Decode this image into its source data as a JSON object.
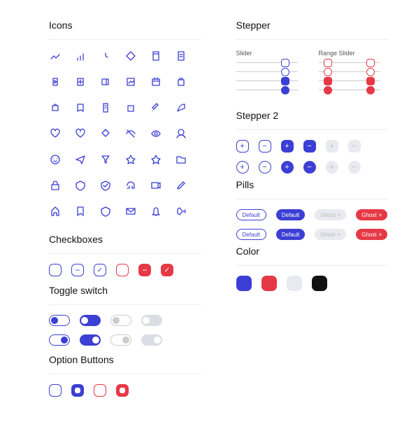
{
  "sections": {
    "icons": "Icons",
    "checkboxes": "Checkboxes",
    "toggle": "Toggle switch",
    "option": "Option Buttons",
    "stepper": "Stepper",
    "stepper2": "Stepper 2",
    "pills": "Pills",
    "color": "Color"
  },
  "slider": {
    "label": "Slider",
    "range_label": "Range Slider"
  },
  "pills": {
    "default": "Default",
    "ghost": "Ghost",
    "close": "×"
  },
  "colors": {
    "blue": "#3b3fd4",
    "red": "#e63946",
    "gray": "#e8eaf0",
    "black": "#111111"
  },
  "icon_names": [
    "chart-line-icon",
    "chart-bar-icon",
    "clock-icon",
    "compass-icon",
    "document-icon",
    "note-icon",
    "play-icon",
    "plus-square-icon",
    "wallet-icon",
    "image-icon",
    "calendar-icon",
    "bag-icon",
    "camera-icon",
    "trash-icon",
    "clipboard-icon",
    "bag-plus-icon",
    "tag-icon",
    "leaf-icon",
    "heart-icon",
    "favorite-icon",
    "diamond-icon",
    "eye-off-icon",
    "eye-icon",
    "user-icon",
    "emoji-icon",
    "send-icon",
    "filter-icon",
    "star-icon",
    "star-outline-icon",
    "folder-icon",
    "lock-icon",
    "shield-icon",
    "check-badge-icon",
    "headphones-icon",
    "video-icon",
    "edit-icon",
    "home-icon",
    "bookmark-icon",
    "shield-outline-icon",
    "mail-icon",
    "bell-icon",
    "volume-icon"
  ]
}
